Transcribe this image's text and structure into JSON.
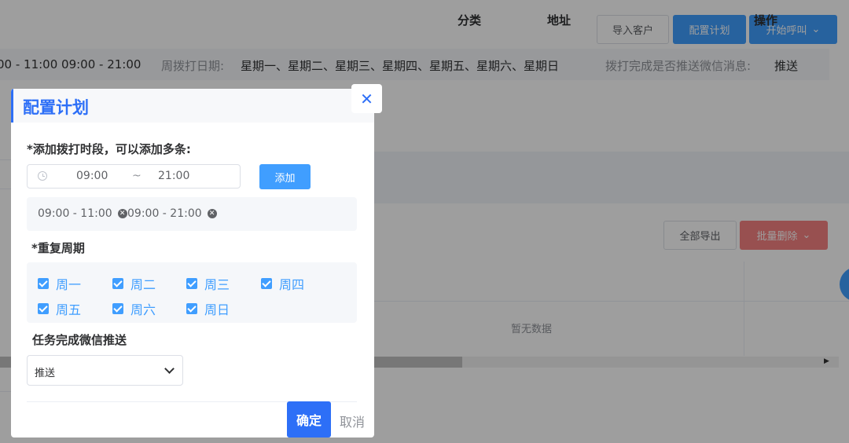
{
  "toolbar": {
    "import_label": "导入客户",
    "config_label": "配置计划",
    "call_label": "开始呼叫"
  },
  "info": {
    "times": "00 - 11:00 09:00 - 21:00",
    "week_label": "周拨打日期:",
    "week_value": "星期一、星期二、星期三、星期四、星期五、星期六、星期日",
    "push_label": "拨打完成是否推送微信消息:",
    "push_value": "推送"
  },
  "table": {
    "export_all_label": "全部导出",
    "batch_delete_label": "批量删除",
    "columns": [
      "分类",
      "地址",
      "操作"
    ],
    "empty_text": "暂无数据"
  },
  "dialog": {
    "title": "配置计划",
    "add_label": "*添加拨打时段，可以添加多条:",
    "time_start": "09:00",
    "time_sep": "~",
    "time_end": "21:00",
    "add_button": "添加",
    "tags": [
      "09:00 - 11:00",
      "09:00 - 21:00"
    ],
    "repeat_label": "*重复周期",
    "days": [
      {
        "label": "周一",
        "checked": true
      },
      {
        "label": "周二",
        "checked": true
      },
      {
        "label": "周三",
        "checked": true
      },
      {
        "label": "周四",
        "checked": true
      },
      {
        "label": "周五",
        "checked": true
      },
      {
        "label": "周六",
        "checked": true
      },
      {
        "label": "周日",
        "checked": true
      }
    ],
    "push_label": "任务完成微信推送",
    "push_value": "推送",
    "ok_label": "确定",
    "cancel_label": "取消"
  },
  "colors": {
    "primary": "#409eff",
    "dialog_accent": "#2d6ff7",
    "danger": "#f56c6c"
  }
}
